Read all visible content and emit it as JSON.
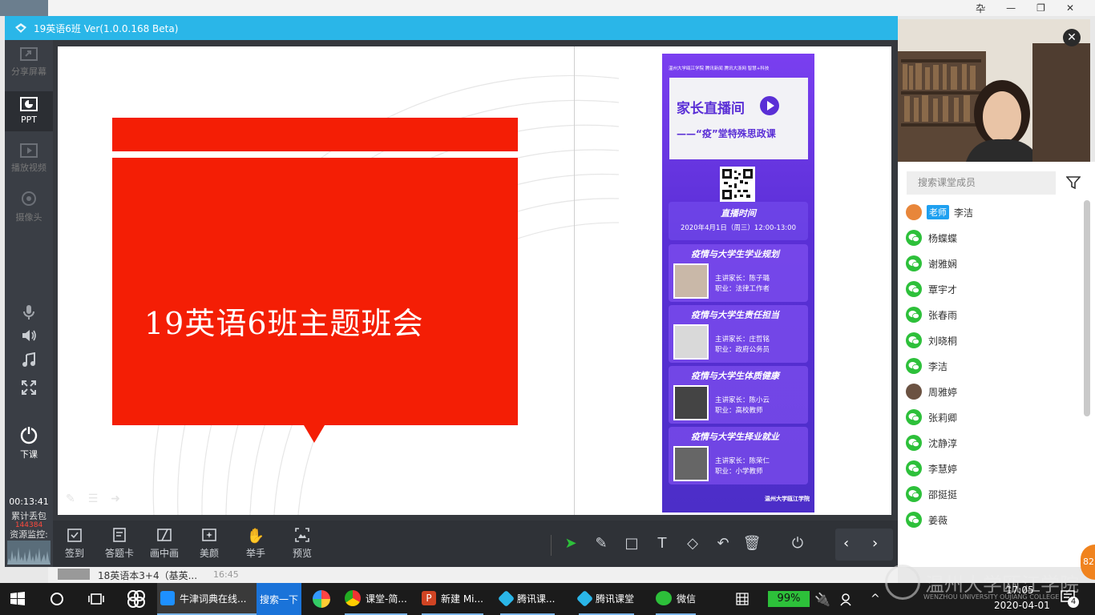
{
  "app": {
    "title": "19英语6班 Ver(1.0.0.168 Beta)"
  },
  "background_window": {
    "controls": [
      "卆",
      "—",
      "❐",
      "✕"
    ]
  },
  "sidebar": {
    "items": [
      {
        "label": "分享屏幕",
        "icon": "share-screen-icon"
      },
      {
        "label": "PPT",
        "icon": "ppt-icon"
      },
      {
        "label": "播放视频",
        "icon": "play-video-icon"
      },
      {
        "label": "摄像头",
        "icon": "camera-icon"
      }
    ],
    "end_class": "下课",
    "timer": "00:13:41",
    "loss_label": "累计丢包",
    "loss_value": "144384",
    "monitor_label": "资源监控:"
  },
  "slide": {
    "title": "19英语6班主题班会",
    "poster": {
      "header_logos": "温州大学瓯江学院  腾讯新闻  腾讯大浙网  智慧+科技",
      "headline": "家长直播间",
      "subheadline": "——“疫”堂特殊思政课",
      "time_label": "直播时间",
      "time_value": "2020年4月1日（周三）12:00-13:00",
      "sessions": [
        {
          "topic": "疫情与大学生学业规划",
          "speaker": "主讲家长：陈子璐",
          "job": "职业：法律工作者"
        },
        {
          "topic": "疫情与大学生责任担当",
          "speaker": "主讲家长：庄哲铭",
          "job": "职业：政府公务员"
        },
        {
          "topic": "疫情与大学生体质健康",
          "speaker": "主讲家长：陈小云",
          "job": "职业：高校教师"
        },
        {
          "topic": "疫情与大学生择业就业",
          "speaker": "主讲家长：陈荣仁",
          "job": "职业：小学教师"
        }
      ],
      "footer": "温州大学瓯江学院"
    }
  },
  "toolbar": {
    "buttons": [
      "签到",
      "答题卡",
      "画中画",
      "美颜",
      "举手",
      "预览"
    ]
  },
  "members": {
    "search_placeholder": "搜索课堂成员",
    "teacher_badge": "老师",
    "list": [
      "李洁",
      "杨蝶蝶",
      "谢雅娴",
      "覃宇才",
      "张春雨",
      "刘晓桐",
      "李洁",
      "周雅婷",
      "张莉卿",
      "沈静淳",
      "李慧婷",
      "邵挺挺",
      "姜薇"
    ]
  },
  "under_window": {
    "text": "18英语本3+4（基英...",
    "time": "16:45"
  },
  "taskbar": {
    "items": [
      "牛津词典在线...",
      "搜索一下",
      "课堂-简...",
      "新建 Mi...",
      "腾讯课...",
      "腾讯课堂",
      "微信"
    ],
    "battery": "99%",
    "clock_time": "17:05",
    "clock_date": "2020-04-01",
    "notification_count": "4",
    "watermark": "温州大学瓯江学院",
    "watermark_en": "WENZHOU UNIVERSITY OUJIANG COLLEGE",
    "float_badge": "82"
  },
  "colors": {
    "accent": "#2ab6e8",
    "red_block": "#f41e05",
    "wechat": "#2dc03a",
    "poster": "#6e35e0"
  }
}
